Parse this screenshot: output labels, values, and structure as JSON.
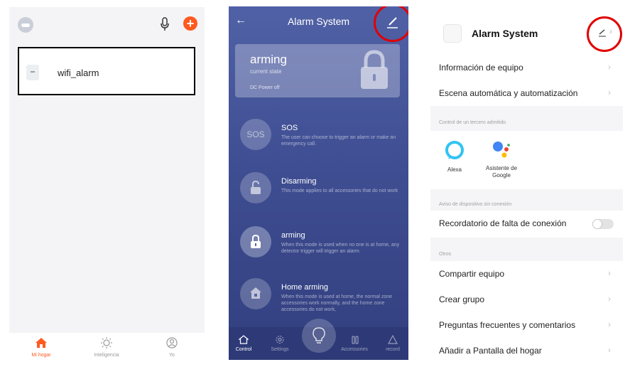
{
  "home_screen": {
    "device_name": "wifi_alarm",
    "tabs": [
      {
        "label": "Mi hogar"
      },
      {
        "label": "Inteligencia"
      },
      {
        "label": "Yo"
      }
    ],
    "accent_color": "#ff5a1f"
  },
  "alarm_screen": {
    "title": "Alarm System",
    "state": {
      "value": "arming",
      "caption": "current state",
      "power": "DC Power off"
    },
    "modes": [
      {
        "icon_text": "SOS",
        "title": "SOS",
        "description": "The user can choose to trigger an alarm or make an emergency call."
      },
      {
        "title": "Disarming",
        "description": "This mode applies to all accessories that do not work"
      },
      {
        "title": "arming",
        "description": "When this mode is used when no one is at home, any detector trigger will trigger an alarm."
      },
      {
        "title": "Home arming",
        "description": "When this mode is used at home, the normal zone accessories work normally, and the home zone accessories do not work,"
      }
    ],
    "bottom_tabs": [
      {
        "label": "Control"
      },
      {
        "label": "Settings"
      },
      {
        "label": "Accessories"
      },
      {
        "label": "record"
      }
    ],
    "background_color": "#3f4e92"
  },
  "settings_screen": {
    "title": "Alarm System",
    "rows_top": [
      {
        "label": "Información de equipo"
      },
      {
        "label": "Escena automática y automatización"
      }
    ],
    "third_party_caption": "Control de un tercero admitido",
    "services": [
      {
        "label": "Alexa"
      },
      {
        "label": "Asistente de Google"
      }
    ],
    "offline_caption": "Aviso de dispositivo sin conexión",
    "offline_row": {
      "label": "Recordatorio de falta de conexión",
      "toggle_on": false
    },
    "others_caption": "Otros",
    "rows_others": [
      {
        "label": "Compartir equipo"
      },
      {
        "label": "Crear grupo"
      },
      {
        "label": "Preguntas frecuentes y comentarios"
      },
      {
        "label": "Añadir a Pantalla del hogar"
      }
    ]
  },
  "highlight_color": "#e00000"
}
